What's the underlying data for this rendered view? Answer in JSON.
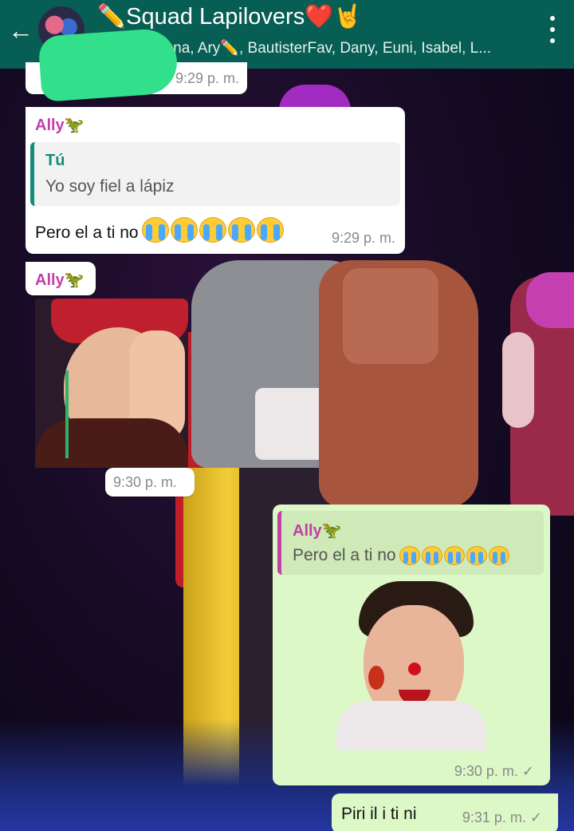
{
  "header": {
    "back_icon": "arrow-left-icon",
    "title": "✏️Squad Lapilovers❤️🤘",
    "subtitle": "Aly, Ana, Ary✏️, BautisterFav, Dany, Euni, Isabel, L...",
    "menu_icon": "more-vert-icon"
  },
  "messages": [
    {
      "id": "m0",
      "time": "9:29 p. m."
    },
    {
      "id": "m1",
      "sender": "Ally🦖",
      "quote_sender": "Tú",
      "quote_text": "Yo soy fiel a lápiz",
      "text": "Pero el a ti no",
      "emoji_count": 5,
      "time": "9:29 p. m."
    },
    {
      "id": "m2",
      "sender": "Ally🦖",
      "image": "photo-boy-crying",
      "time": "9:30 p. m."
    },
    {
      "id": "m3",
      "quote_sender": "Ally🦖",
      "quote_text": "Pero el a ti no",
      "emoji_count": 5,
      "image": "photo-clown-face",
      "time": "9:30 p. m.",
      "status": "✓"
    },
    {
      "id": "m4",
      "text": "Piri il i ti ni",
      "time": "9:31 p. m.",
      "status": "✓"
    }
  ],
  "colors": {
    "header": "#075e54",
    "incoming": "#ffffff",
    "outgoing": "#dcf8c6",
    "sender_name": "#c23fa8",
    "quote_you": "#128c7e"
  }
}
